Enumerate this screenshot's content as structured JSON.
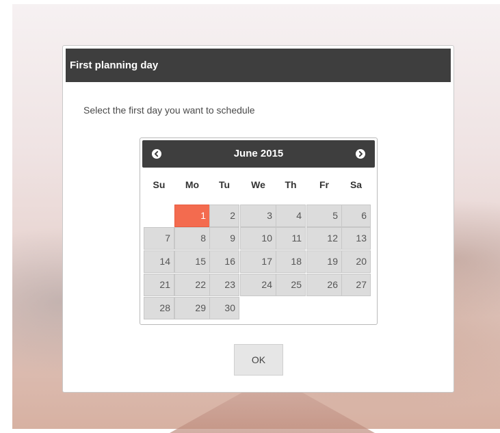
{
  "dialog": {
    "title": "First planning day",
    "instruction": "Select the first day you want to schedule",
    "ok_label": "OK"
  },
  "calendar": {
    "month_label": "June 2015",
    "weekdays": [
      "Su",
      "Mo",
      "Tu",
      "We",
      "Th",
      "Fr",
      "Sa"
    ],
    "first_weekday_index": 1,
    "days": [
      "1",
      "2",
      "3",
      "4",
      "5",
      "6",
      "7",
      "8",
      "9",
      "10",
      "11",
      "12",
      "13",
      "14",
      "15",
      "16",
      "17",
      "18",
      "19",
      "20",
      "21",
      "22",
      "23",
      "24",
      "25",
      "26",
      "27",
      "28",
      "29",
      "30"
    ],
    "selected_day": "1",
    "prev_icon": "chevron-left-circle-icon",
    "next_icon": "chevron-right-circle-icon"
  },
  "colors": {
    "header_bg": "#3e3e3e",
    "selected_day": "#f36b4f",
    "day_cell": "#dcdcdc"
  }
}
